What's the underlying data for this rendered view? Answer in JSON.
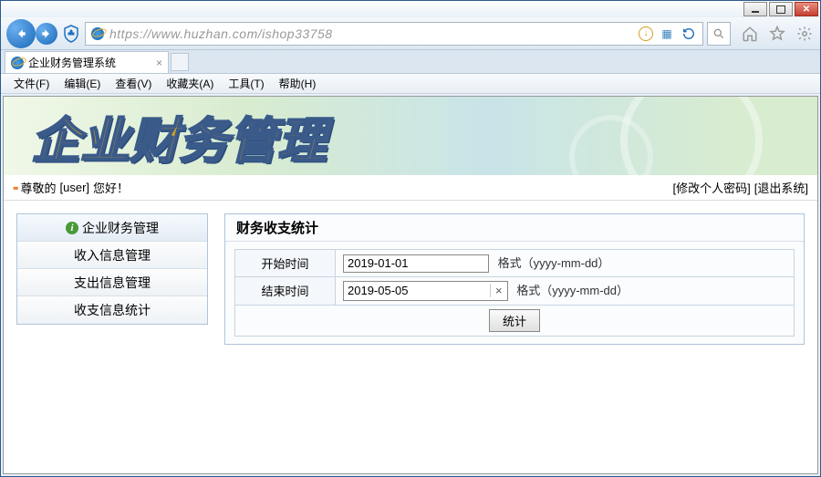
{
  "browser": {
    "url_watermark": "https://www.huzhan.com/ishop33758",
    "tab_title": "企业财务管理系统",
    "menus": {
      "file": "文件(F)",
      "edit": "编辑(E)",
      "view": "查看(V)",
      "favorites": "收藏夹(A)",
      "tools": "工具(T)",
      "help": "帮助(H)"
    }
  },
  "banner": {
    "title": "企业财务管理"
  },
  "greeting": {
    "prefix": "尊敬的",
    "user": "[user]",
    "suffix": "您好！",
    "change_pwd": "[修改个人密码]",
    "logout": "[退出系统]"
  },
  "sidebar": {
    "items": [
      {
        "label": "企业财务管理",
        "active": true,
        "icon": true
      },
      {
        "label": "收入信息管理"
      },
      {
        "label": "支出信息管理"
      },
      {
        "label": "收支信息统计"
      }
    ]
  },
  "panel": {
    "title": "财务收支统计",
    "rows": [
      {
        "label": "开始时间",
        "value": "2019-01-01",
        "hint": "格式（yyyy-mm-dd）",
        "clear": false
      },
      {
        "label": "结束时间",
        "value": "2019-05-05",
        "hint": "格式（yyyy-mm-dd）",
        "clear": true
      }
    ],
    "submit": "统计"
  }
}
